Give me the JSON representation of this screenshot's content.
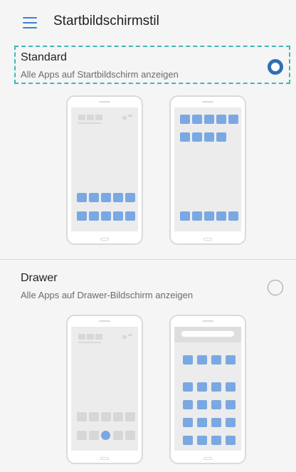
{
  "header": {
    "title": "Startbildschirmstil",
    "menu_icon": "menu-icon"
  },
  "options": [
    {
      "title": "Standard",
      "description": "Alle Apps auf Startbildschirm anzeigen",
      "selected": true
    },
    {
      "title": "Drawer",
      "description": "Alle Apps auf Drawer-Bildschirm anzeigen",
      "selected": false
    }
  ],
  "colors": {
    "accent": "#2f6fb5",
    "app_icon": "#7aa8e3",
    "focus_outline": "#3fb7b7"
  }
}
